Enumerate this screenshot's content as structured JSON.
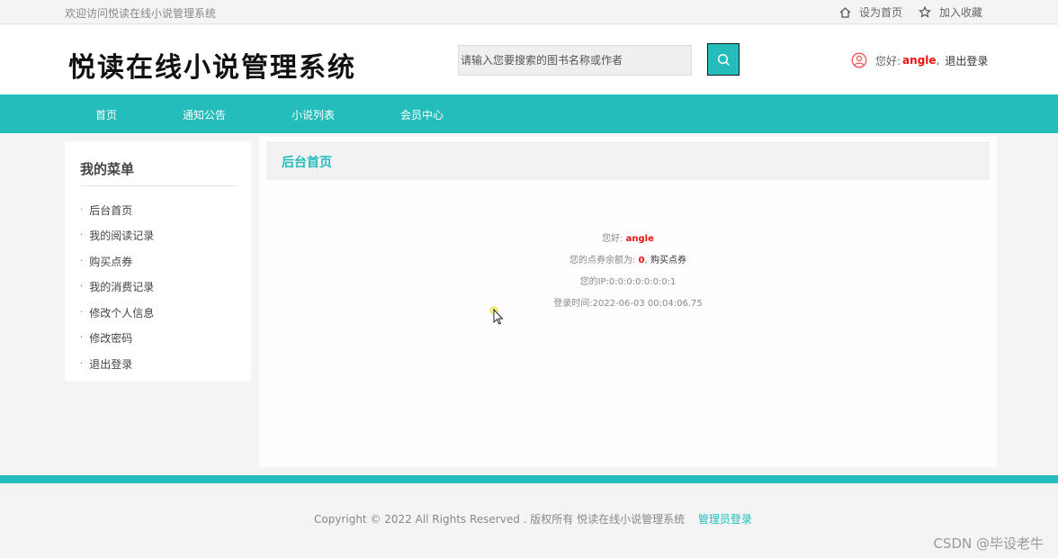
{
  "topbar": {
    "welcome": "欢迎访问悦读在线小说管理系统",
    "set_home": "设为首页",
    "add_favorite": "加入收藏"
  },
  "header": {
    "logo": "悦读在线小说管理系统",
    "search_placeholder": "请输入您要搜索的图书名称或作者",
    "greeting": "您好:",
    "username": "angle",
    "separator": ",",
    "logout": "退出登录"
  },
  "nav": {
    "items": [
      "首页",
      "通知公告",
      "小说列表",
      "会员中心"
    ]
  },
  "sidebar": {
    "title": "我的菜单",
    "items": [
      "后台首页",
      "我的阅读记录",
      "购买点券",
      "我的消费记录",
      "修改个人信息",
      "修改密码",
      "退出登录"
    ]
  },
  "main": {
    "title": "后台首页",
    "greeting_label": "您好:",
    "username": "angle",
    "balance_label": "您的点券余额为:",
    "balance": "0",
    "balance_sep": ",",
    "buy_link": "购买点券",
    "ip_line": "您的IP:0:0:0:0:0:0:0:1",
    "login_time_line": "登录时间:2022-06-03 00:04:06.75"
  },
  "footer": {
    "copyright": "Copyright © 2022 All Rights Reserved . 版权所有  悦读在线小说管理系统",
    "admin_login": "管理员登录",
    "watermark": "CSDN @毕设老牛"
  },
  "colors": {
    "accent": "#25bcbc",
    "highlight": "#ee1111"
  }
}
